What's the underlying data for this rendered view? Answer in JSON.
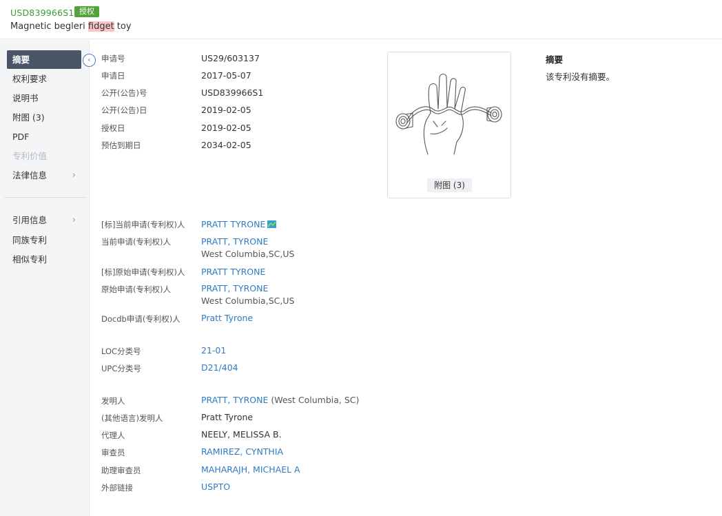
{
  "header": {
    "pub_no": "USD839966S1",
    "badge": "授权",
    "title_pre": "Magnetic begleri ",
    "title_hl": "fidget",
    "title_post": " toy"
  },
  "sidebar": {
    "items": [
      {
        "label": "摘要"
      },
      {
        "label": "权利要求"
      },
      {
        "label": "说明书"
      },
      {
        "label": "附图 (3)"
      },
      {
        "label": "PDF"
      },
      {
        "label": "专利价值"
      },
      {
        "label": "法律信息"
      },
      {
        "label": "引用信息"
      },
      {
        "label": "同族专利"
      },
      {
        "label": "相似专利"
      }
    ],
    "collapse_icon": "chevron-left-icon"
  },
  "basic": [
    {
      "label": "申请号",
      "value": "US29/603137"
    },
    {
      "label": "申请日",
      "value": "2017-05-07"
    },
    {
      "label": "公开(公告)号",
      "value": "USD839966S1"
    },
    {
      "label": "公开(公告)日",
      "value": "2019-02-05"
    },
    {
      "label": "授权日",
      "value": "2019-02-05"
    },
    {
      "label": "预估到期日",
      "value": "2034-02-05"
    }
  ],
  "figure": {
    "label": "附图 (3)"
  },
  "abstract": {
    "title": "摘要",
    "text": "该专利没有摘要。"
  },
  "parties": [
    {
      "label": "[标]当前申请(专利权)人",
      "value": "PRATT TYRONE"
    },
    {
      "label": "当前申请(专利权)人",
      "value": "PRATT, TYRONE",
      "sub": "West Columbia,SC,US"
    },
    {
      "label": "[标]原始申请(专利权)人",
      "value": "PRATT TYRONE"
    },
    {
      "label": "原始申请(专利权)人",
      "value": "PRATT, TYRONE",
      "sub": "West Columbia,SC,US"
    },
    {
      "label": "Docdb申请(专利权)人",
      "value": "Pratt Tyrone"
    }
  ],
  "classes": [
    {
      "label": "LOC分类号",
      "value": "21-01"
    },
    {
      "label": "UPC分类号",
      "value": "D21/404"
    }
  ],
  "people": [
    {
      "label": "发明人",
      "value": "PRATT, TYRONE",
      "extra": " (West Columbia, SC)"
    },
    {
      "label": "(其他语言)发明人",
      "value": "Pratt Tyrone"
    },
    {
      "label": "代理人",
      "value": "NEELY, MELISSA B."
    },
    {
      "label": "审查员",
      "value": "RAMIREZ, CYNTHIA"
    },
    {
      "label": "助理审查员",
      "value": "MAHARAJH, MICHAEL A"
    },
    {
      "label": "外部链接",
      "value": "USPTO"
    }
  ],
  "colors": {
    "accent": "#2f7ac6",
    "badge": "#52a43a",
    "active_nav": "#4a5568"
  }
}
